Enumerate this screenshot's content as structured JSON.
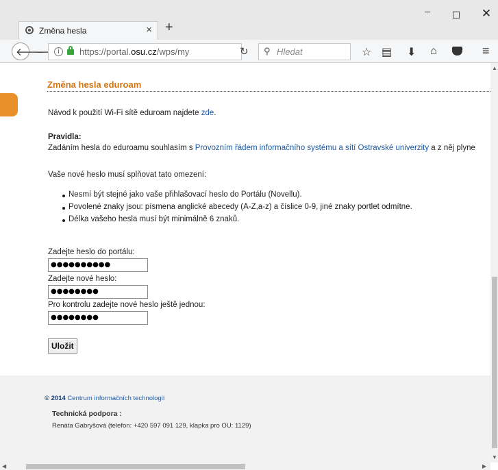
{
  "browser": {
    "tab_title": "Změna hesla",
    "tab_close": "×",
    "new_tab": "+",
    "url_prefix": "https://portal.",
    "url_domain": "osu.cz",
    "url_suffix": "/wps/my",
    "search_placeholder": "Hledat",
    "win_min": "–",
    "win_max": "☐",
    "win_close": "✕",
    "icons": {
      "back": "back-arrow-icon",
      "forward": "forward-arrow-icon",
      "info": "info-icon",
      "lock": "lock-icon",
      "reader": "reader-view-icon",
      "reload": "reload-icon",
      "search": "search-icon",
      "bookmark": "star-icon",
      "library": "clipboard-icon",
      "downloads": "download-icon",
      "home": "home-icon",
      "pocket": "pocket-icon",
      "menu": "hamburger-menu-icon"
    }
  },
  "page": {
    "title": "Změna hesla eduroam",
    "intro_text": "Návod k použití Wi-Fi sítě eduroam najdete ",
    "intro_link": "zde",
    "intro_end": ".",
    "rules_label": "Pravidla:",
    "rules_text_before": "Zadáním hesla do eduroamu souhlasím s ",
    "rules_link": "Provozním řádem informačního systému a sítí Ostravské univerzity",
    "rules_text_after": " a z něj plyne",
    "constraints_intro": "Vaše nové heslo musí splňovat tato omezení:",
    "constraints": [
      "Nesmí být stejné jako vaše přihlašovací heslo do Portálu (Novellu).",
      "Povolené znaky jsou: písmena anglické abecedy (A-Z,a-z) a číslice 0-9, jiné znaky portlet odmítne.",
      "Délka vašeho hesla musí být minimálně 6 znaků."
    ],
    "form": {
      "portal_password_label": "Zadejte heslo do portálu:",
      "portal_password_value": "●●●●●●●●●●",
      "new_password_label": "Zadejte nové heslo:",
      "new_password_value": "●●●●●●●●",
      "confirm_password_label": "Pro kontrolu zadejte nové heslo ještě jednou:",
      "confirm_password_value": "●●●●●●●●",
      "save_label": "Uložit"
    }
  },
  "footer": {
    "copyright_year": "© 2014",
    "copyright_org": "Centrum informačních technologií",
    "support_label": "Technická podpora :",
    "support_text": "Renáta Gabryšová (telefon: +420 597 091 129, klapka pro OU: 1129)"
  },
  "colors": {
    "title_orange": "#d27514",
    "link_blue": "#1a5aa6",
    "side_tab_orange": "#e8912b"
  }
}
